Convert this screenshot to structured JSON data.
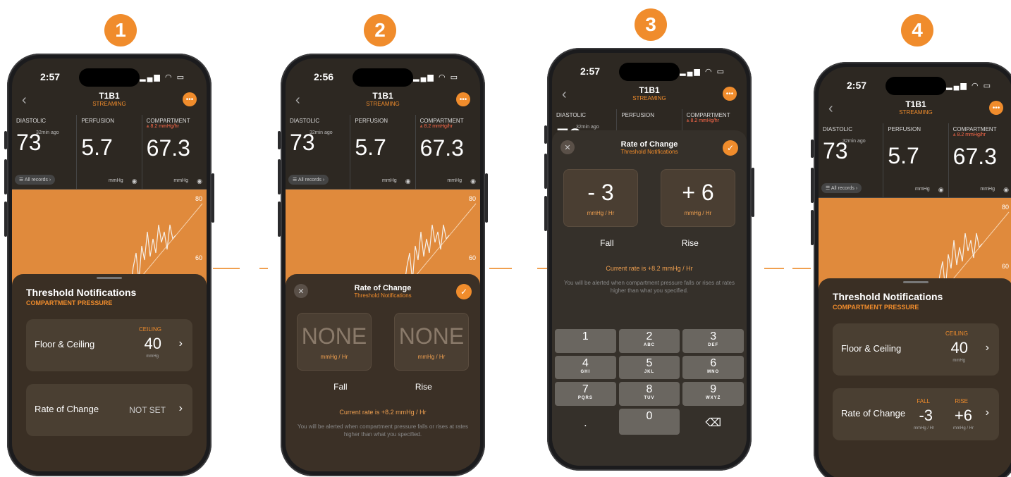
{
  "steps": [
    "1",
    "2",
    "3",
    "4"
  ],
  "phones": [
    {
      "time": "2:57",
      "screen": "sheet",
      "sheet": {
        "title": "Threshold Notifications",
        "subtitle": "COMPARTMENT PRESSURE",
        "floor_label": "Floor & Ceiling",
        "ceiling_tag": "CEILING",
        "ceiling_value": "40",
        "ceiling_unit": "mmHg",
        "rate_label": "Rate of Change",
        "rate_value": "NOT SET"
      }
    },
    {
      "time": "2:56",
      "screen": "modal",
      "modal": {
        "title": "Rate of Change",
        "subtitle": "Threshold Notifications",
        "fall_value": "NONE",
        "rise_value": "NONE",
        "unit": "mmHg / Hr",
        "fall_label": "Fall",
        "rise_label": "Rise",
        "current": "Current rate is +8.2 mmHg / Hr",
        "note": "You will be alerted when compartment pressure falls or rises at rates higher than what you specified."
      }
    },
    {
      "time": "2:57",
      "screen": "keypad",
      "modal": {
        "title": "Rate of Change",
        "subtitle": "Threshold Notifications",
        "fall_value": "- 3",
        "rise_value": "+ 6",
        "unit": "mmHg / Hr",
        "fall_label": "Fall",
        "rise_label": "Rise",
        "current": "Current rate is +8.2 mmHg / Hr",
        "note": "You will be alerted when compartment pressure falls or rises at rates higher than what you specified."
      },
      "keypad": [
        {
          "digit": "1",
          "letters": ""
        },
        {
          "digit": "2",
          "letters": "ABC"
        },
        {
          "digit": "3",
          "letters": "DEF"
        },
        {
          "digit": "4",
          "letters": "GHI"
        },
        {
          "digit": "5",
          "letters": "JKL"
        },
        {
          "digit": "6",
          "letters": "MNO"
        },
        {
          "digit": "7",
          "letters": "PQRS"
        },
        {
          "digit": "8",
          "letters": "TUV"
        },
        {
          "digit": "9",
          "letters": "WXYZ"
        },
        {
          "digit": ".",
          "letters": ""
        },
        {
          "digit": "0",
          "letters": ""
        },
        {
          "digit": "⌫",
          "letters": ""
        }
      ]
    },
    {
      "time": "2:57",
      "screen": "sheet2",
      "sheet": {
        "title": "Threshold Notifications",
        "subtitle": "COMPARTMENT PRESSURE",
        "floor_label": "Floor & Ceiling",
        "ceiling_tag": "CEILING",
        "ceiling_value": "40",
        "ceiling_unit": "mmHg",
        "rate_label": "Rate of Change",
        "fall_tag": "FALL",
        "fall_value": "-3",
        "rise_tag": "RISE",
        "rise_value": "+6",
        "rate_unit": "mmHg / Hr"
      }
    }
  ],
  "header": {
    "title": "T1B1",
    "status": "STREAMING"
  },
  "metrics": {
    "diastolic_label": "DIASTOLIC",
    "diastolic_value": "73",
    "diastolic_ago": "32min ago",
    "records": "☰ All records ›",
    "perfusion_label": "PERFUSION",
    "perfusion_value": "5.7",
    "compartment_label": "COMPARTMENT",
    "compartment_extra": "⩓ 8.2 mmHg/hr",
    "compartment_value": "67.3",
    "unit": "mmHg"
  },
  "chart_ticks": [
    "80",
    "60"
  ],
  "colors": {
    "accent": "#f08c2c",
    "chart": "#e08a3c"
  }
}
